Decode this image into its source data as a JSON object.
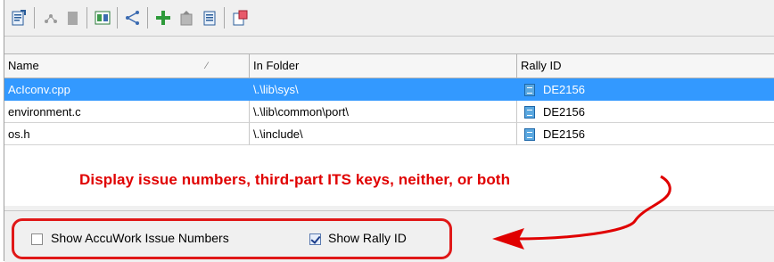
{
  "toolbar": {
    "icons": [
      "properties-icon",
      "merge-icon",
      "document-icon",
      "diff-icon",
      "history-icon",
      "add-element-icon",
      "promote-icon",
      "checkout-icon",
      "send-to-issue-icon"
    ]
  },
  "grid": {
    "columns": [
      "Name",
      "In Folder",
      "Rally ID"
    ],
    "rows": [
      {
        "name": "AcIconv.cpp",
        "folder": "\\.\\lib\\sys\\",
        "rally": "DE2156",
        "selected": true
      },
      {
        "name": "environment.c",
        "folder": "\\.\\lib\\common\\port\\",
        "rally": "DE2156",
        "selected": false
      },
      {
        "name": "os.h",
        "folder": "\\.\\include\\",
        "rally": "DE2156",
        "selected": false
      }
    ]
  },
  "annotation": "Display issue numbers, third-part ITS keys, neither, or both",
  "options": {
    "show_accuwork": {
      "label": "Show AccuWork Issue Numbers",
      "checked": false
    },
    "show_rally": {
      "label": "Show Rally ID",
      "checked": true
    }
  },
  "colors": {
    "accent_red": "#e00000",
    "selection": "#3399ff"
  }
}
